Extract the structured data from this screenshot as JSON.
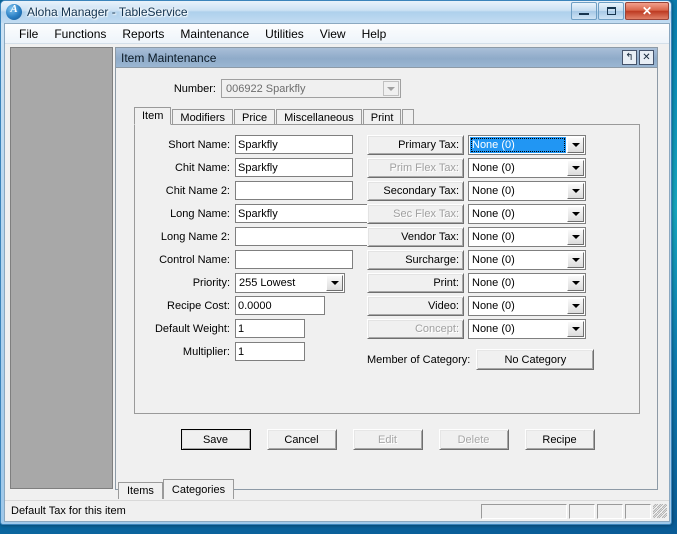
{
  "window": {
    "title": "Aloha Manager - TableService",
    "icon": "aloha-logo-icon",
    "minimize": "–",
    "maximize": "□",
    "close": "✕"
  },
  "menubar": {
    "items": [
      "File",
      "Functions",
      "Reports",
      "Maintenance",
      "Utilities",
      "View",
      "Help"
    ]
  },
  "dialog": {
    "title": "Item Maintenance",
    "restore_glyph": "↰",
    "close_glyph": "✕",
    "number": {
      "label": "Number:",
      "value": "006922 Sparkfly"
    },
    "tabs": [
      {
        "label": "Item",
        "selected": true
      },
      {
        "label": "Modifiers",
        "selected": false
      },
      {
        "label": "Price",
        "selected": false
      },
      {
        "label": "Miscellaneous",
        "selected": false
      },
      {
        "label": "Print",
        "selected": false
      }
    ],
    "left_fields": [
      {
        "label": "Short Name:",
        "value": "Sparkfly",
        "width": "w-118",
        "type": "text"
      },
      {
        "label": "Chit Name:",
        "value": "Sparkfly",
        "width": "w-118",
        "type": "text"
      },
      {
        "label": "Chit Name 2:",
        "value": "",
        "width": "w-118",
        "type": "text"
      },
      {
        "label": "Long Name:",
        "value": "Sparkfly",
        "width": "w-148",
        "type": "text"
      },
      {
        "label": "Long Name 2:",
        "value": "",
        "width": "w-148",
        "type": "text"
      },
      {
        "label": "Control Name:",
        "value": "",
        "width": "w-118",
        "type": "text"
      },
      {
        "label": "Priority:",
        "value": "255 Lowest",
        "width": "w-110",
        "type": "combo"
      },
      {
        "label": "Recipe Cost:",
        "value": "0.0000",
        "width": "w-90",
        "type": "text"
      },
      {
        "label": "Default Weight:",
        "value": "1",
        "width": "w-70",
        "type": "text"
      },
      {
        "label": "Multiplier:",
        "value": "1",
        "width": "w-70",
        "type": "text"
      }
    ],
    "right_fields": [
      {
        "label": "Primary Tax:",
        "value": "None (0)",
        "disabled": false,
        "focused": true
      },
      {
        "label": "Prim Flex Tax:",
        "value": "None (0)",
        "disabled": true,
        "focused": false
      },
      {
        "label": "Secondary Tax:",
        "value": "None (0)",
        "disabled": false,
        "focused": false
      },
      {
        "label": "Sec Flex Tax:",
        "value": "None (0)",
        "disabled": true,
        "focused": false
      },
      {
        "label": "Vendor Tax:",
        "value": "None (0)",
        "disabled": false,
        "focused": false
      },
      {
        "label": "Surcharge:",
        "value": "None (0)",
        "disabled": false,
        "focused": false
      },
      {
        "label": "Print:",
        "value": "None (0)",
        "disabled": false,
        "focused": false
      },
      {
        "label": "Video:",
        "value": "None (0)",
        "disabled": false,
        "focused": false
      },
      {
        "label": "Concept:",
        "value": "None (0)",
        "disabled": true,
        "focused": false
      }
    ],
    "member_of_category": {
      "label": "Member of Category:",
      "button": "No Category"
    },
    "actions": [
      {
        "label": "Save",
        "disabled": false,
        "default": true
      },
      {
        "label": "Cancel",
        "disabled": false,
        "default": false
      },
      {
        "label": "Edit",
        "disabled": true,
        "default": false
      },
      {
        "label": "Delete",
        "disabled": true,
        "default": false
      },
      {
        "label": "Recipe",
        "disabled": false,
        "default": false
      }
    ]
  },
  "bottom_tabs": [
    {
      "label": "Items",
      "selected": true
    },
    {
      "label": "Categories",
      "selected": false
    }
  ],
  "statusbar": {
    "text": "Default Tax for this item",
    "panels": [
      "",
      "",
      "",
      ""
    ]
  },
  "colors": {
    "accent_selection": "#2196f3",
    "dialog_titlebar": "#8fabc9",
    "window_face": "#f0f0f0",
    "side_pane": "#a8a8a8",
    "close_button": "#bd3a22"
  }
}
